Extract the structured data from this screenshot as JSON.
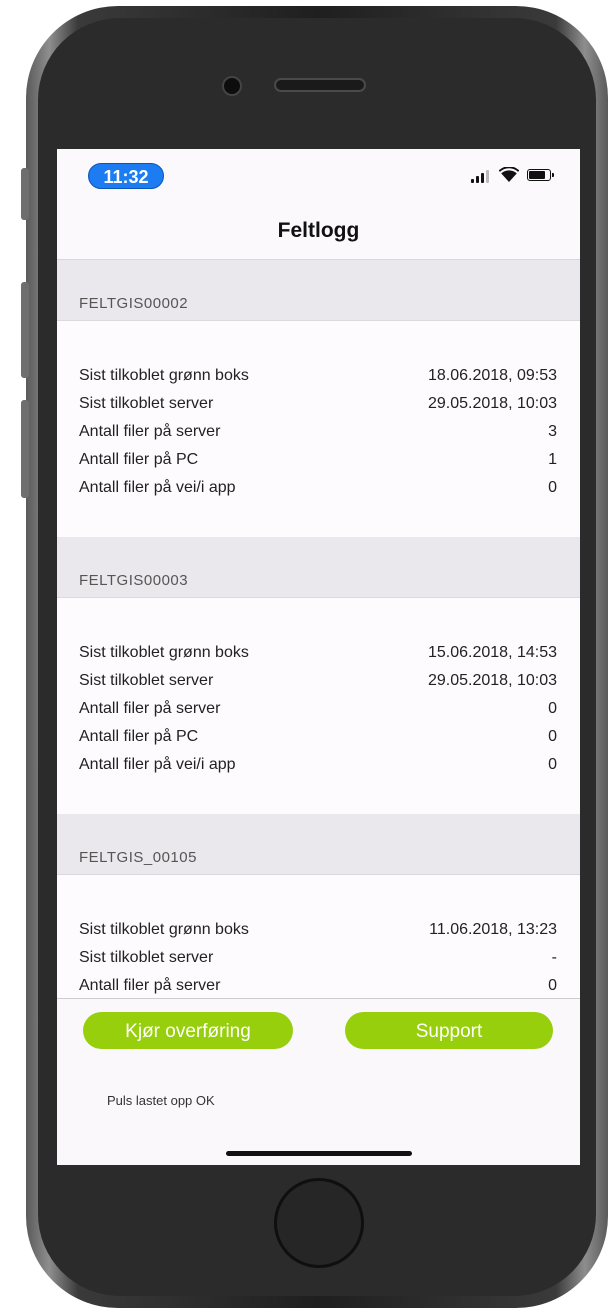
{
  "status_bar": {
    "time": "11:32"
  },
  "nav": {
    "title": "Feltlogg"
  },
  "sections": [
    {
      "id": "FELTGIS00002",
      "rows": [
        {
          "label": "Sist tilkoblet grønn boks",
          "value": "18.06.2018, 09:53"
        },
        {
          "label": "Sist tilkoblet server",
          "value": "29.05.2018, 10:03"
        },
        {
          "label": "Antall filer på server",
          "value": "3"
        },
        {
          "label": "Antall filer på PC",
          "value": "1"
        },
        {
          "label": "Antall filer på vei/i app",
          "value": "0"
        }
      ]
    },
    {
      "id": "FELTGIS00003",
      "rows": [
        {
          "label": "Sist tilkoblet grønn boks",
          "value": "15.06.2018, 14:53"
        },
        {
          "label": "Sist tilkoblet server",
          "value": "29.05.2018, 10:03"
        },
        {
          "label": "Antall filer på server",
          "value": "0"
        },
        {
          "label": "Antall filer på PC",
          "value": "0"
        },
        {
          "label": "Antall filer på vei/i app",
          "value": "0"
        }
      ]
    },
    {
      "id": "FELTGIS_00105",
      "rows": [
        {
          "label": "Sist tilkoblet grønn boks",
          "value": "11.06.2018, 13:23"
        },
        {
          "label": "Sist tilkoblet server",
          "value": "-"
        },
        {
          "label": "Antall filer på server",
          "value": "0"
        }
      ]
    }
  ],
  "footer": {
    "transfer_label": "Kjør overføring",
    "support_label": "Support",
    "status_message": "Puls lastet opp OK"
  },
  "colors": {
    "accent_green": "#97cf0d",
    "time_pill_blue": "#1e7cf2"
  },
  "icons": [
    "signal-icon",
    "wifi-icon",
    "battery-icon"
  ]
}
